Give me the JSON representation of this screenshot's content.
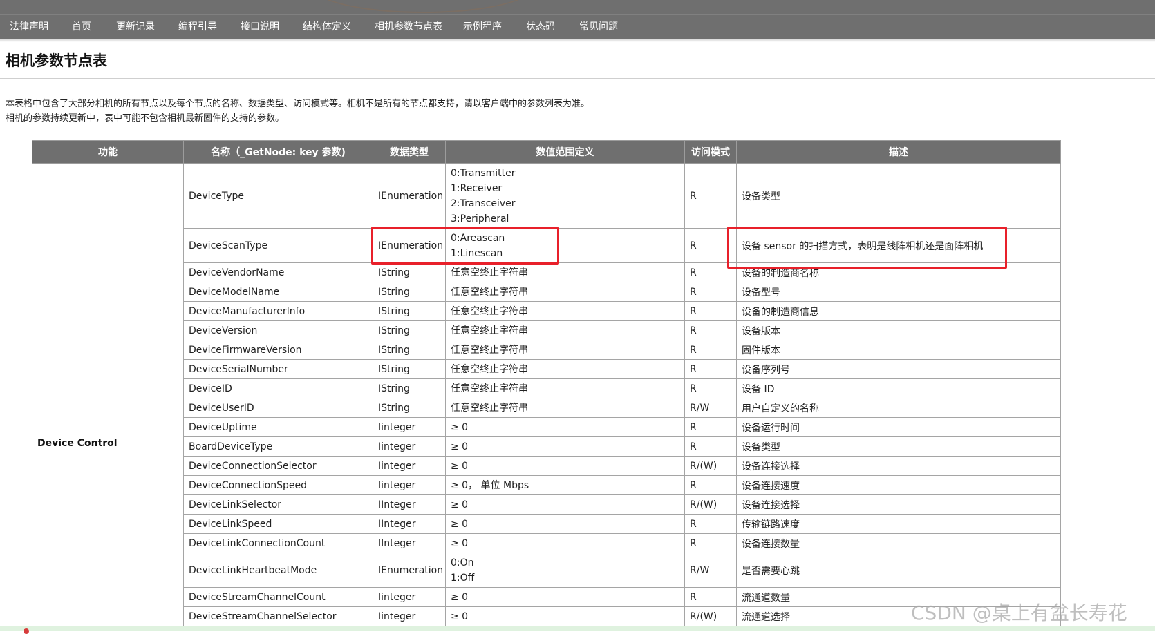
{
  "nav": {
    "items": [
      "法律声明",
      "首页",
      "更新记录",
      "编程引导",
      "接口说明",
      "结构体定义",
      "相机参数节点表",
      "示例程序",
      "状态码",
      "常见问题"
    ]
  },
  "page": {
    "title": "相机参数节点表",
    "intro_line1": "本表格中包含了大部分相机的所有节点以及每个节点的名称、数据类型、访问模式等。相机不是所有的节点都支持，请以客户端中的参数列表为准。",
    "intro_line2": "相机的参数持续更新中，表中可能不包含相机最新固件的支持的参数。"
  },
  "table": {
    "headers": [
      "功能",
      "名称（_GetNode: key 参数)",
      "数据类型",
      "数值范围定义",
      "访问模式",
      "描述"
    ],
    "group": "Device Control",
    "rows": [
      {
        "name": "DeviceType",
        "type": "IEnumeration",
        "range": [
          "0:Transmitter",
          "1:Receiver",
          "2:Transceiver",
          "3:Peripheral"
        ],
        "access": "R",
        "desc": "设备类型"
      },
      {
        "name": "DeviceScanType",
        "type": "IEnumeration",
        "range": [
          "0:Areascan",
          "1:Linescan"
        ],
        "access": "R",
        "desc": "设备 sensor 的扫描方式，表明是线阵相机还是面阵相机"
      },
      {
        "name": "DeviceVendorName",
        "type": "IString",
        "range": [
          "任意空终止字符串"
        ],
        "access": "R",
        "desc": "设备的制造商名称"
      },
      {
        "name": "DeviceModelName",
        "type": "IString",
        "range": [
          "任意空终止字符串"
        ],
        "access": "R",
        "desc": "设备型号"
      },
      {
        "name": "DeviceManufacturerInfo",
        "type": "IString",
        "range": [
          "任意空终止字符串"
        ],
        "access": "R",
        "desc": "设备的制造商信息"
      },
      {
        "name": "DeviceVersion",
        "type": "IString",
        "range": [
          "任意空终止字符串"
        ],
        "access": "R",
        "desc": "设备版本"
      },
      {
        "name": "DeviceFirmwareVersion",
        "type": "IString",
        "range": [
          "任意空终止字符串"
        ],
        "access": "R",
        "desc": "固件版本"
      },
      {
        "name": "DeviceSerialNumber",
        "type": "IString",
        "range": [
          "任意空终止字符串"
        ],
        "access": "R",
        "desc": "设备序列号"
      },
      {
        "name": "DeviceID",
        "type": "IString",
        "range": [
          "任意空终止字符串"
        ],
        "access": "R",
        "desc": "设备 ID"
      },
      {
        "name": "DeviceUserID",
        "type": "IString",
        "range": [
          "任意空终止字符串"
        ],
        "access": "R/W",
        "desc": "用户自定义的名称"
      },
      {
        "name": "DeviceUptime",
        "type": "Iinteger",
        "range": [
          "≥ 0"
        ],
        "access": "R",
        "desc": "设备运行时间"
      },
      {
        "name": "BoardDeviceType",
        "type": "Iinteger",
        "range": [
          "≥ 0"
        ],
        "access": "R",
        "desc": "设备类型"
      },
      {
        "name": "DeviceConnectionSelector",
        "type": "Iinteger",
        "range": [
          "≥ 0"
        ],
        "access": "R/(W)",
        "desc": "设备连接选择"
      },
      {
        "name": "DeviceConnectionSpeed",
        "type": "Iinteger",
        "range": [
          "≥ 0， 单位 Mbps"
        ],
        "access": "R",
        "desc": "设备连接速度"
      },
      {
        "name": "DeviceLinkSelector",
        "type": "IInteger",
        "range": [
          "≥ 0"
        ],
        "access": "R/(W)",
        "desc": "设备连接选择"
      },
      {
        "name": "DeviceLinkSpeed",
        "type": "IInteger",
        "range": [
          "≥ 0"
        ],
        "access": "R",
        "desc": "传输链路速度"
      },
      {
        "name": "DeviceLinkConnectionCount",
        "type": "IInteger",
        "range": [
          "≥ 0"
        ],
        "access": "R",
        "desc": "设备连接数量"
      },
      {
        "name": "DeviceLinkHeartbeatMode",
        "type": "IEnumeration",
        "range": [
          "0:On",
          "1:Off"
        ],
        "access": "R/W",
        "desc": "是否需要心跳"
      },
      {
        "name": "DeviceStreamChannelCount",
        "type": "Iinteger",
        "range": [
          "≥ 0"
        ],
        "access": "R",
        "desc": "流通道数量"
      },
      {
        "name": "DeviceStreamChannelSelector",
        "type": "Iinteger",
        "range": [
          "≥ 0"
        ],
        "access": "R/(W)",
        "desc": "流通道选择"
      }
    ]
  },
  "watermark": "CSDN @桌上有盆长寿花",
  "colors": {
    "nav_bg": "#6f6f6f",
    "header_bg": "#6f6f6f",
    "highlight": "#e8202a"
  }
}
